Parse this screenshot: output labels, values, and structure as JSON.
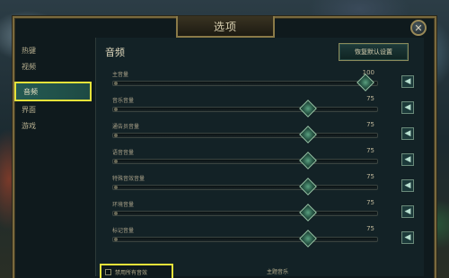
{
  "dialog": {
    "title": "选项",
    "close_glyph": "✕"
  },
  "sidebar": {
    "items": [
      {
        "label": "热键",
        "active": false
      },
      {
        "label": "视频",
        "active": false
      },
      {
        "label": "音频",
        "active": true
      },
      {
        "label": "界面",
        "active": false
      },
      {
        "label": "游戏",
        "active": false
      }
    ]
  },
  "panel": {
    "title": "音频",
    "reset_label": "恢复默认设置",
    "sliders": [
      {
        "label": "主音量",
        "value": "100"
      },
      {
        "label": "音乐音量",
        "value": "75"
      },
      {
        "label": "通告员音量",
        "value": "75"
      },
      {
        "label": "语音音量",
        "value": "75"
      },
      {
        "label": "特殊音效音量",
        "value": "75"
      },
      {
        "label": "环境音量",
        "value": "75"
      },
      {
        "label": "标记音量",
        "value": "75"
      }
    ],
    "disable_all_label": "禁用所有音效",
    "music_section_label": "主题音乐"
  },
  "icons": {
    "mute": "speaker-icon",
    "close": "close-icon"
  },
  "colors": {
    "highlight": "#e6e23a",
    "accent_teal": "#245a52",
    "frame_gold": "#7a6a3e"
  }
}
